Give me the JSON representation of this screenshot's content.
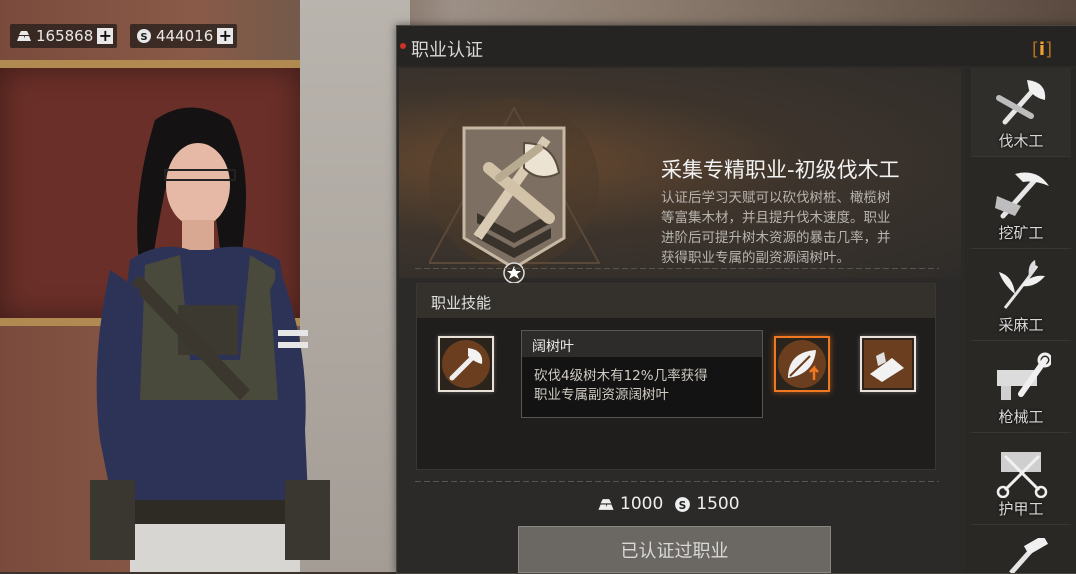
{
  "currency": {
    "gold_value": "165868",
    "silver_value": "444016",
    "plus": "+"
  },
  "panel": {
    "title": "职业认证",
    "info": "i"
  },
  "job": {
    "title": "采集专精职业-初级伐木工",
    "desc_lines": [
      "认证后学习天赋可以砍伐树桩、橄榄树",
      "等富集木材，并且提升伐木速度。职业",
      "进阶后可提升树木资源的暴击几率，并",
      "获得职业专属的副资源阔树叶。"
    ]
  },
  "skills": {
    "title": "职业技能",
    "tooltip": {
      "title": "阔树叶",
      "body_lines": [
        "砍伐4级树木有12%几率获得",
        "职业专属副资源阔树叶"
      ]
    },
    "items": [
      {
        "name": "axe-skill-icon"
      },
      {
        "name": "leaf-skill-icon",
        "active": true
      },
      {
        "name": "log-skill-icon"
      }
    ]
  },
  "cost": {
    "gold": "1000",
    "silver": "1500"
  },
  "certify_button": "已认证过职业",
  "tabs": [
    {
      "label": "伐木工",
      "icon": "axe-icon"
    },
    {
      "label": "挖矿工",
      "icon": "pickaxe-icon"
    },
    {
      "label": "采麻工",
      "icon": "plant-icon"
    },
    {
      "label": "枪械工",
      "icon": "wrench-icon"
    },
    {
      "label": "护甲工",
      "icon": "scissors-icon"
    }
  ],
  "colors": {
    "accent_orange": "#f07820",
    "dot_red": "#d0302a",
    "info_orange": "#f0a030"
  }
}
